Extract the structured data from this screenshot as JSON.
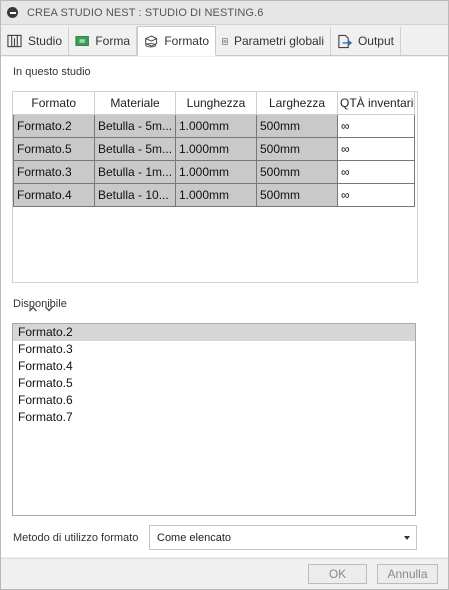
{
  "window": {
    "title": "CREA STUDIO NEST : STUDIO DI NESTING.6"
  },
  "tabs": [
    {
      "label": "Studio",
      "icon": "studio-icon",
      "active": false
    },
    {
      "label": "Forma",
      "icon": "forma-icon",
      "active": false
    },
    {
      "label": "Formato",
      "icon": "formato-icon",
      "active": true
    },
    {
      "label": "Parametri globali",
      "icon": "parametri-icon",
      "active": false
    },
    {
      "label": "Output",
      "icon": "output-icon",
      "active": false
    }
  ],
  "in_study": {
    "label": "In questo studio",
    "columns": [
      "Formato",
      "Materiale",
      "Lunghezza",
      "Larghezza",
      "QTÀ inventario"
    ],
    "rows": [
      {
        "formato": "Formato.2",
        "materiale": "Betulla - 5m...",
        "lunghezza": "1.000mm",
        "larghezza": "500mm",
        "qta": "∞"
      },
      {
        "formato": "Formato.5",
        "materiale": "Betulla - 5m...",
        "lunghezza": "1.000mm",
        "larghezza": "500mm",
        "qta": "∞"
      },
      {
        "formato": "Formato.3",
        "materiale": "Betulla - 1m...",
        "lunghezza": "1.000mm",
        "larghezza": "500mm",
        "qta": "∞"
      },
      {
        "formato": "Formato.4",
        "materiale": "Betulla - 10...",
        "lunghezza": "1.000mm",
        "larghezza": "500mm",
        "qta": "∞"
      }
    ]
  },
  "available": {
    "label": "Disponibile",
    "items": [
      "Formato.2",
      "Formato.3",
      "Formato.4",
      "Formato.5",
      "Formato.6",
      "Formato.7"
    ],
    "selected_index": 0
  },
  "method": {
    "label": "Metodo di utilizzo formato",
    "value": "Come elencato"
  },
  "buttons": {
    "ok": "OK",
    "cancel": "Annulla"
  }
}
